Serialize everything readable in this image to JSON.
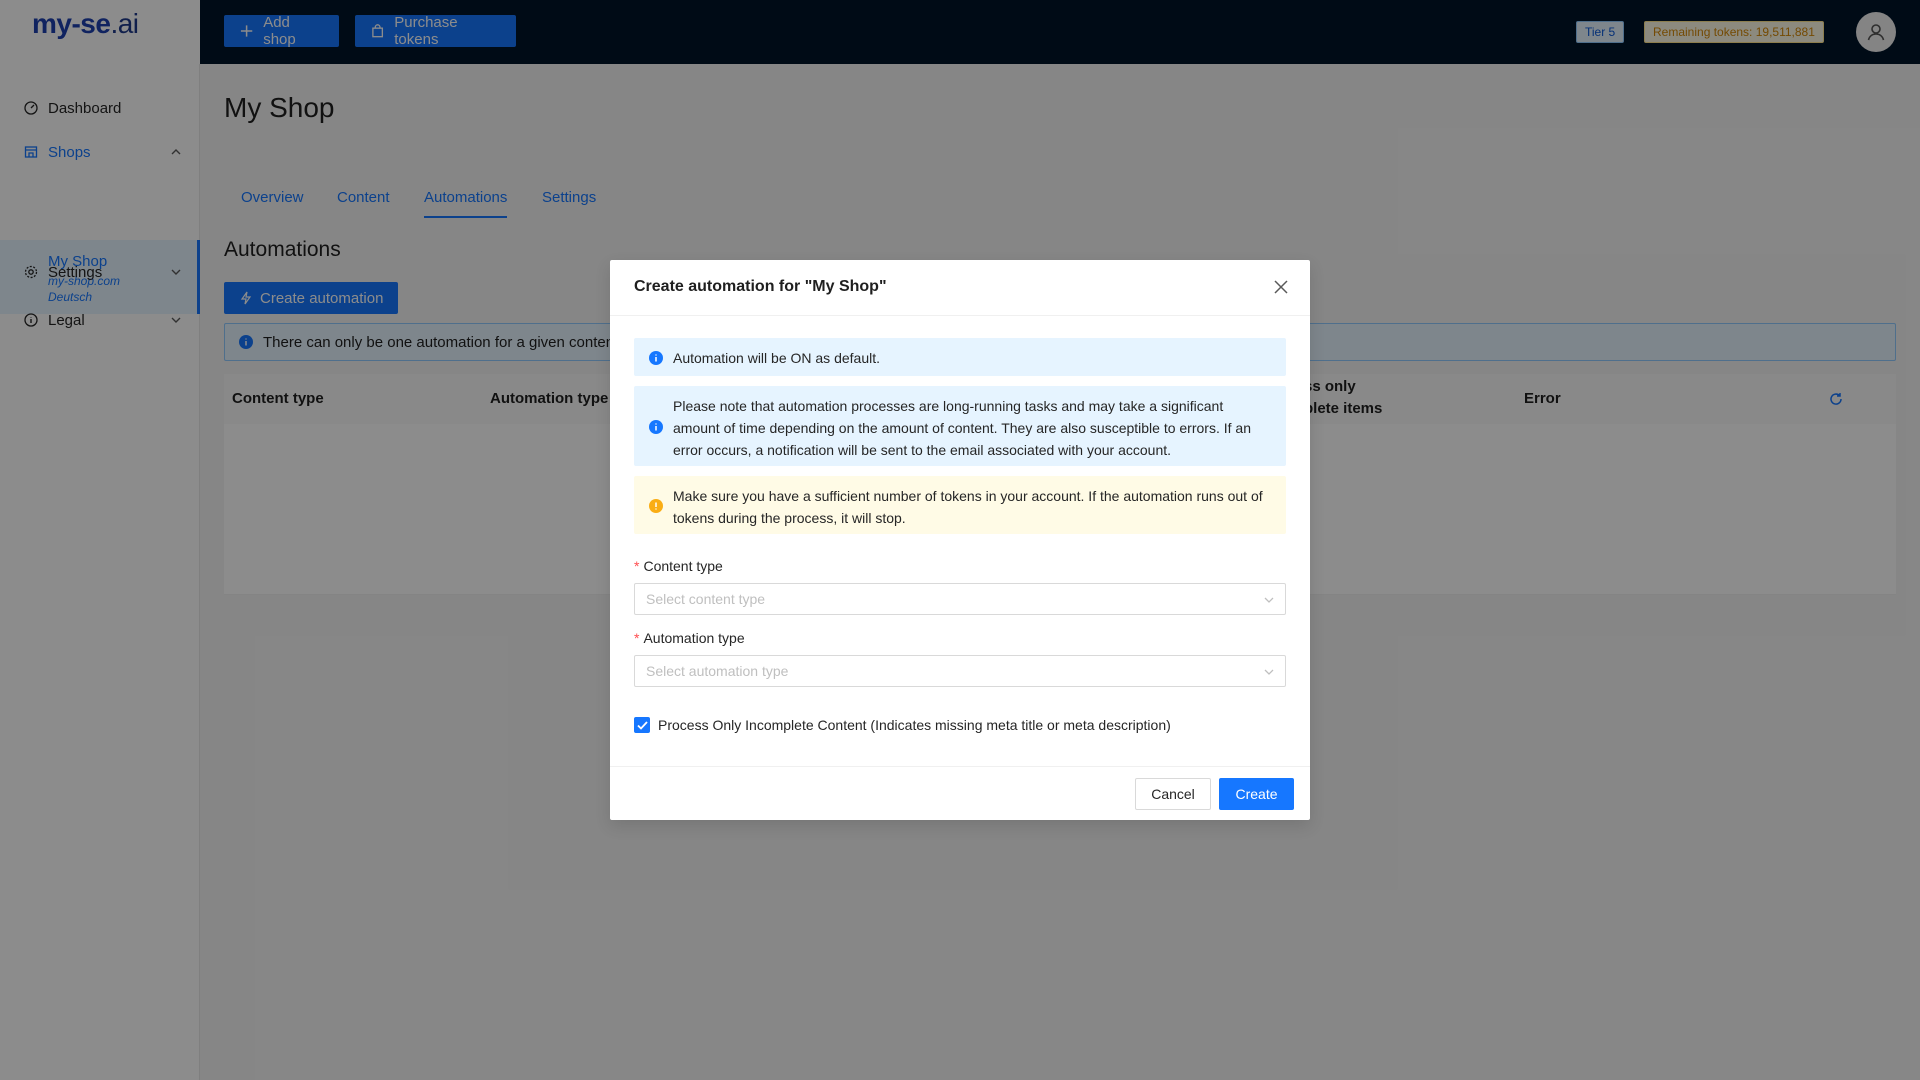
{
  "brand": {
    "logo_text": "my-se",
    "logo_suffix": ".ai"
  },
  "topbar": {
    "add_shop": "Add shop",
    "purchase_tokens": "Purchase tokens",
    "tier": "Tier 5",
    "remaining_tokens": "Remaining tokens: 19,511,881"
  },
  "sidebar": {
    "dashboard": "Dashboard",
    "shops": "Shops",
    "shop": {
      "name": "My Shop",
      "domain": "my-shop.com",
      "language": "Deutsch"
    },
    "settings": "Settings",
    "legal": "Legal"
  },
  "main": {
    "title": "My Shop",
    "tabs": [
      "Overview",
      "Content",
      "Automations",
      "Settings"
    ],
    "active_tab": "Automations",
    "section_title": "Automations",
    "create_button": "Create automation",
    "info": "There can only be one automation for a given content",
    "table_headers": [
      "Content type",
      "Automation type",
      "ss only",
      "plete items",
      "Error"
    ]
  },
  "modal": {
    "title": "Create automation for \"My Shop\"",
    "alert_default": "Automation will be ON as default.",
    "alert_note": "Please note that automation processes are long-running tasks and may take a significant amount of time depending on the amount of content. They are also susceptible to errors. If an error occurs, a notification will be sent to the email associated with your account.",
    "alert_tokens": "Make sure you have a sufficient number of tokens in your account. If the automation runs out of tokens during the process, it will stop.",
    "content_type_label": "Content type",
    "content_type_placeholder": "Select content type",
    "automation_type_label": "Automation type",
    "automation_type_placeholder": "Select automation type",
    "checkbox_label": "Process Only Incomplete Content (Indicates missing meta title or meta description)",
    "checkbox_checked": true,
    "cancel": "Cancel",
    "create": "Create"
  },
  "colors": {
    "primary": "#1677ff",
    "header": "#001529",
    "warning": "#faad14"
  },
  "icons": [
    "plus-icon",
    "shopping-bag-icon",
    "user-icon",
    "dashboard-icon",
    "shop-icon",
    "gear-icon",
    "info-circle-icon",
    "chevron-down-icon",
    "chevron-up-icon",
    "close-icon",
    "reload-icon",
    "thunderbolt-icon",
    "check-icon",
    "warning-circle-icon"
  ]
}
